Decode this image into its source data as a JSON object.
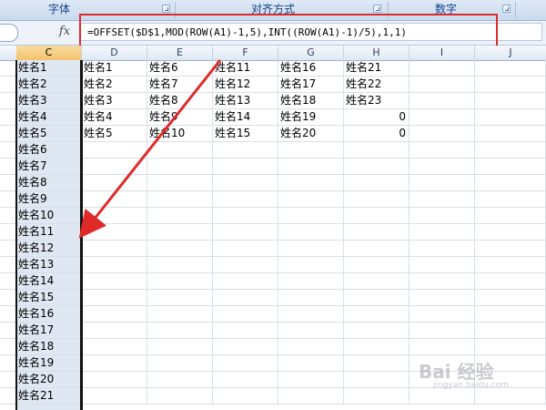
{
  "ribbon": {
    "groups": [
      {
        "label": "字体"
      },
      {
        "label": "对齐方式"
      },
      {
        "label": "数字"
      }
    ]
  },
  "formula_bar": {
    "fx_label": "fx",
    "formula": "=OFFSET($D$1,MOD(ROW(A1)-1,5),INT((ROW(A1)-1)/5),1,1)"
  },
  "columns": [
    "C",
    "D",
    "E",
    "F",
    "G",
    "H",
    "I",
    "J"
  ],
  "active_column": "C",
  "rows": [
    {
      "C": "姓名1",
      "D": "姓名1",
      "E": "姓名6",
      "F": "姓名11",
      "G": "姓名16",
      "H": "姓名21"
    },
    {
      "C": "姓名2",
      "D": "姓名2",
      "E": "姓名7",
      "F": "姓名12",
      "G": "姓名17",
      "H": "姓名22"
    },
    {
      "C": "姓名3",
      "D": "姓名3",
      "E": "姓名8",
      "F": "姓名13",
      "G": "姓名18",
      "H": "姓名23"
    },
    {
      "C": "姓名4",
      "D": "姓名4",
      "E": "姓名9",
      "F": "姓名14",
      "G": "姓名19",
      "H": "0"
    },
    {
      "C": "姓名5",
      "D": "姓名5",
      "E": "姓名10",
      "F": "姓名15",
      "G": "姓名20",
      "H": "0"
    },
    {
      "C": "姓名6"
    },
    {
      "C": "姓名7"
    },
    {
      "C": "姓名8"
    },
    {
      "C": "姓名9"
    },
    {
      "C": "姓名10"
    },
    {
      "C": "姓名11"
    },
    {
      "C": "姓名12"
    },
    {
      "C": "姓名13"
    },
    {
      "C": "姓名14"
    },
    {
      "C": "姓名15"
    },
    {
      "C": "姓名16"
    },
    {
      "C": "姓名17"
    },
    {
      "C": "姓名18"
    },
    {
      "C": "姓名19"
    },
    {
      "C": "姓名20"
    },
    {
      "C": "姓名21"
    }
  ],
  "colors": {
    "annotation_red": "#e02a2a",
    "selected_column": "#dfe7f2",
    "active_header": "#f3c26c"
  },
  "watermark": {
    "text": "Bai 经验",
    "sub": "jingyan.baidu.com"
  }
}
